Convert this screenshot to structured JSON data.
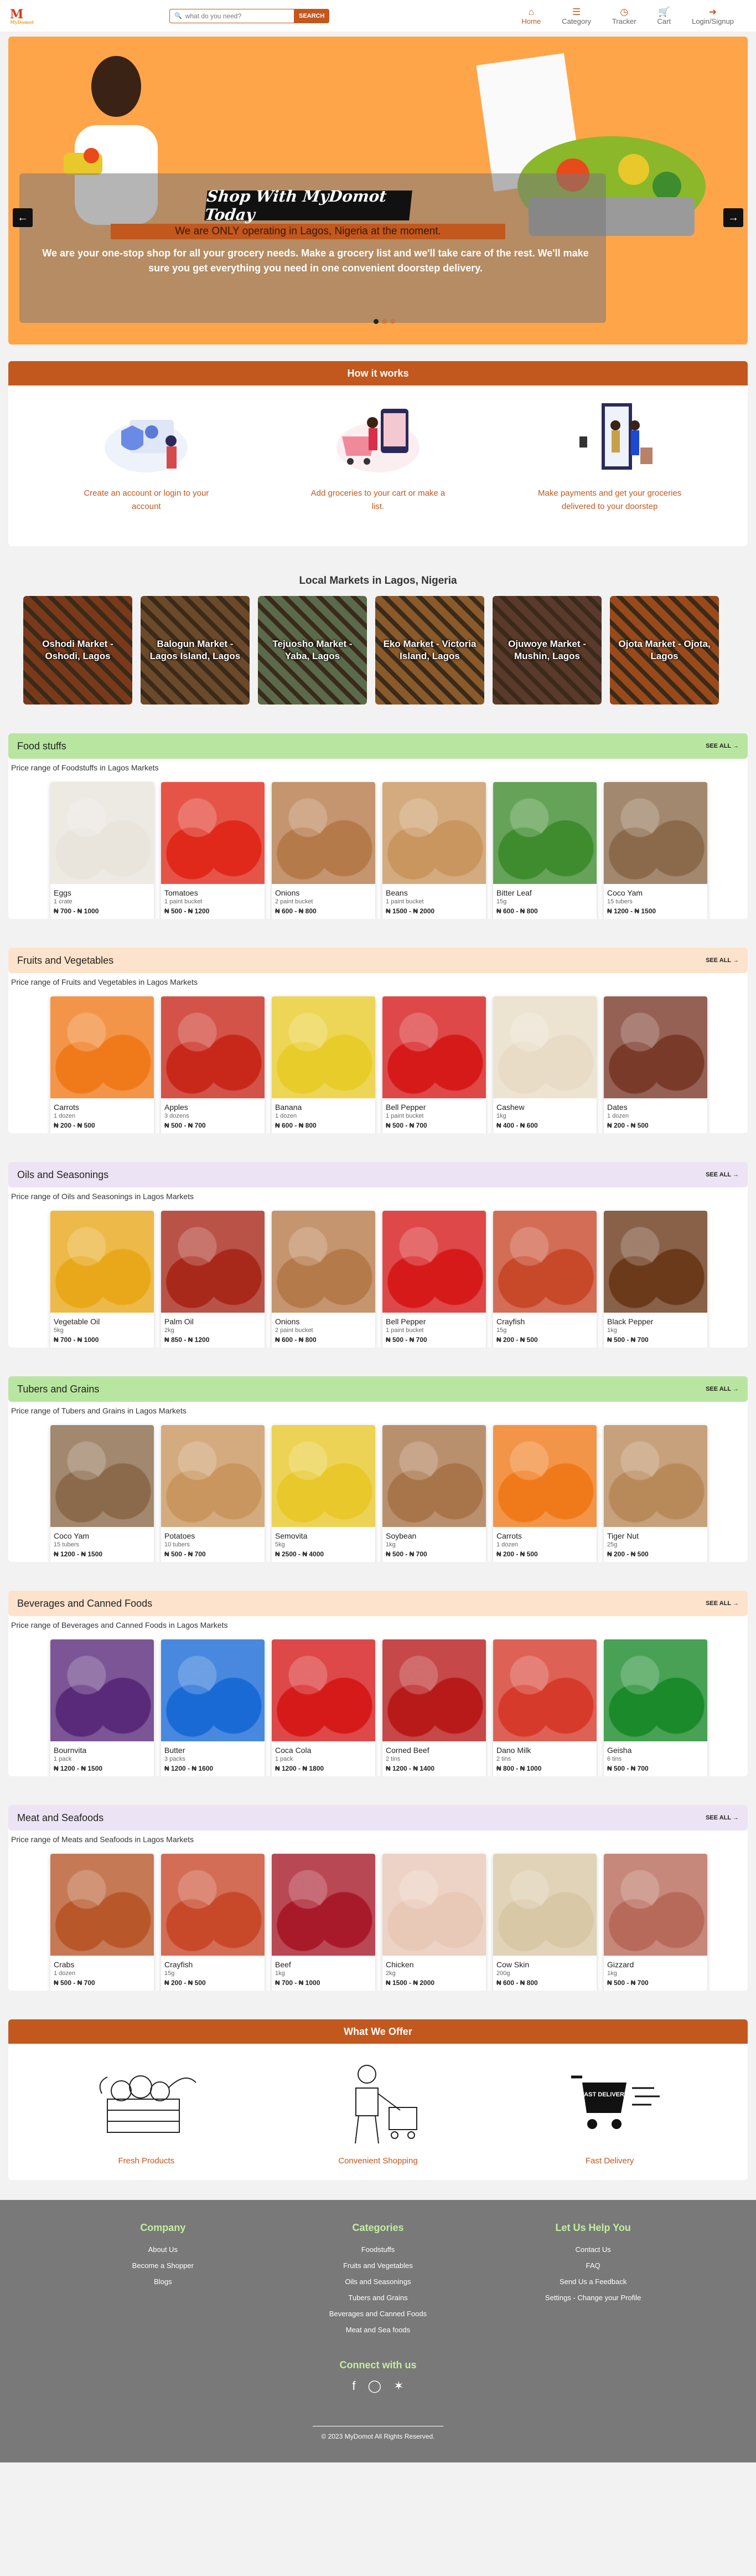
{
  "header": {
    "logo_text": "M",
    "logo_sub": "MyDomot",
    "search": {
      "placeholder": "what do you need?",
      "button_label": "SEARCH"
    },
    "nav": [
      {
        "label": "Home",
        "icon": "home-icon"
      },
      {
        "label": "Category",
        "icon": "list-icon"
      },
      {
        "label": "Tracker",
        "icon": "clock-icon"
      },
      {
        "label": "Cart",
        "icon": "cart-icon",
        "badge": "0"
      },
      {
        "label": "Login/Signup",
        "icon": "login-icon"
      }
    ]
  },
  "hero": {
    "title": "Shop With MyDomot Today",
    "notice": "We are ONLY operating in Lagos, Nigeria at the moment.",
    "description": "We are your one-stop shop for all your grocery needs. Make a grocery list and we'll take care of the rest. We'll make sure you get everything you need in one convenient doorstep delivery.",
    "slides": 3,
    "active_slide": 1
  },
  "how_it_works": {
    "title": "How it works",
    "steps": [
      {
        "text": "Create an account or login to your account"
      },
      {
        "text": "Add groceries to your cart or make a list."
      },
      {
        "text": "Make payments and get your groceries delivered to your doorstep"
      }
    ]
  },
  "markets": {
    "title": "Local Markets in Lagos, Nigeria",
    "items": [
      {
        "name": "Oshodi Market - Oshodi, Lagos",
        "color": "#7a3a1a"
      },
      {
        "name": "Balogun Market - Lagos Island, Lagos",
        "color": "#6b4a2a"
      },
      {
        "name": "Tejuosho Market - Yaba, Lagos",
        "color": "#5a6a4a"
      },
      {
        "name": "Eko Market - Victoria Island, Lagos",
        "color": "#8a5a2a"
      },
      {
        "name": "Ojuwoye Market - Mushin, Lagos",
        "color": "#5a3a2a"
      },
      {
        "name": "Ojota Market - Ojota, Lagos",
        "color": "#9a4a1a"
      }
    ]
  },
  "see_all": "SEE ALL",
  "categories": [
    {
      "title": "Food stuffs",
      "sub": "Price range of Foodstuffs in Lagos Markets",
      "color": "#b8e6a0",
      "products": [
        {
          "name": "Eggs",
          "qty": "1 crate",
          "price": "₦ 700 - ₦ 1000",
          "color": "#e9e4dc"
        },
        {
          "name": "Tomatoes",
          "qty": "1 paint bucket",
          "price": "₦ 500 - ₦ 1200",
          "color": "#e0291a"
        },
        {
          "name": "Onions",
          "qty": "2 paint bucket",
          "price": "₦ 600 - ₦ 800",
          "color": "#b57a4a"
        },
        {
          "name": "Beans",
          "qty": "1 paint bucket",
          "price": "₦ 1500 - ₦ 2000",
          "color": "#c8965e"
        },
        {
          "name": "Bitter Leaf",
          "qty": "15g",
          "price": "₦ 600 - ₦ 800",
          "color": "#3e8c2e"
        },
        {
          "name": "Coco Yam",
          "qty": "15 tubers",
          "price": "₦ 1200 - ₦ 1500",
          "color": "#8a6a4a"
        }
      ]
    },
    {
      "title": "Fruits and Vegetables",
      "sub": "Price range of Fruits and Vegetables in Lagos Markets",
      "color": "#fde3cc",
      "products": [
        {
          "name": "Carrots",
          "qty": "1 dozen",
          "price": "₦ 200 - ₦ 500",
          "color": "#f07a1a"
        },
        {
          "name": "Apples",
          "qty": "3 dozens",
          "price": "₦ 500 - ₦ 700",
          "color": "#c8281a"
        },
        {
          "name": "Banana",
          "qty": "1 dozen",
          "price": "₦ 600 - ₦ 800",
          "color": "#e8cc2a"
        },
        {
          "name": "Bell Pepper",
          "qty": "1 paint bucket",
          "price": "₦ 500 - ₦ 700",
          "color": "#d61a1a"
        },
        {
          "name": "Cashew",
          "qty": "1kg",
          "price": "₦ 400 - ₦ 600",
          "color": "#e8dcc6"
        },
        {
          "name": "Dates",
          "qty": "1 dozen",
          "price": "₦ 200 - ₦ 500",
          "color": "#7a3a2a"
        }
      ]
    },
    {
      "title": "Oils and Seasonings",
      "sub": "Price range of Oils and Seasonings in Lagos Markets",
      "color": "#ece4f4",
      "products": [
        {
          "name": "Vegetable Oil",
          "qty": "5kg",
          "price": "₦ 700 - ₦ 1000",
          "color": "#e8a81a"
        },
        {
          "name": "Palm Oil",
          "qty": "2kg",
          "price": "₦ 850 - ₦ 1200",
          "color": "#a8281a"
        },
        {
          "name": "Onions",
          "qty": "2 paint bucket",
          "price": "₦ 600 - ₦ 800",
          "color": "#b57a4a"
        },
        {
          "name": "Bell Pepper",
          "qty": "1 paint bucket",
          "price": "₦ 500 - ₦ 700",
          "color": "#d61a1a"
        },
        {
          "name": "Crayfish",
          "qty": "15g",
          "price": "₦ 200 - ₦ 500",
          "color": "#c8482a"
        },
        {
          "name": "Black Pepper",
          "qty": "1kg",
          "price": "₦ 500 - ₦ 700",
          "color": "#6a3a1a"
        }
      ]
    },
    {
      "title": "Tubers and Grains",
      "sub": "Price range of Tubers and Grains in Lagos Markets",
      "color": "#b8e6a0",
      "products": [
        {
          "name": "Coco Yam",
          "qty": "15 tubers",
          "price": "₦ 1200 - ₦ 1500",
          "color": "#8a6a4a"
        },
        {
          "name": "Potatoes",
          "qty": "10 tubers",
          "price": "₦ 500 - ₦ 700",
          "color": "#c8965e"
        },
        {
          "name": "Semovita",
          "qty": "5kg",
          "price": "₦ 2500 - ₦ 4000",
          "color": "#e8c82a"
        },
        {
          "name": "Soybean",
          "qty": "1kg",
          "price": "₦ 500 - ₦ 700",
          "color": "#a8744a"
        },
        {
          "name": "Carrots",
          "qty": "1 dozen",
          "price": "₦ 200 - ₦ 500",
          "color": "#f07a1a"
        },
        {
          "name": "Tiger Nut",
          "qty": "25g",
          "price": "₦ 200 - ₦ 500",
          "color": "#b88a5a"
        }
      ]
    },
    {
      "title": "Beverages and Canned Foods",
      "sub": "Price range of Beverages and Canned Foods in Lagos Markets",
      "color": "#fde3cc",
      "products": [
        {
          "name": "Bournvita",
          "qty": "1 pack",
          "price": "₦ 1200 - ₦ 1500",
          "color": "#5a2a7a"
        },
        {
          "name": "Butter",
          "qty": "3 packs",
          "price": "₦ 1200 - ₦ 1600",
          "color": "#1a6ad6"
        },
        {
          "name": "Coca Cola",
          "qty": "1 pack",
          "price": "₦ 1200 - ₦ 1800",
          "color": "#d61a1a"
        },
        {
          "name": "Corned Beef",
          "qty": "2 tins",
          "price": "₦ 1200 - ₦ 1400",
          "color": "#b81a1a"
        },
        {
          "name": "Dano Milk",
          "qty": "2 tins",
          "price": "₦ 800 - ₦ 1000",
          "color": "#d63a2a"
        },
        {
          "name": "Geisha",
          "qty": "6 tins",
          "price": "₦ 500 - ₦ 700",
          "color": "#1a8a2a"
        }
      ]
    },
    {
      "title": "Meat and Seafoods",
      "sub": "Price range of Meats and Seafoods in Lagos Markets",
      "color": "#ece4f4",
      "products": [
        {
          "name": "Crabs",
          "qty": "1 dozen",
          "price": "₦ 500 - ₦ 700",
          "color": "#b8582a"
        },
        {
          "name": "Crayfish",
          "qty": "15g",
          "price": "₦ 200 - ₦ 500",
          "color": "#c8482a"
        },
        {
          "name": "Beef",
          "qty": "1kg",
          "price": "₦ 700 - ₦ 1000",
          "color": "#a81a2a"
        },
        {
          "name": "Chicken",
          "qty": "2kg",
          "price": "₦ 1500 - ₦ 2000",
          "color": "#e8c8b6"
        },
        {
          "name": "Cow Skin",
          "qty": "200g",
          "price": "₦ 600 - ₦ 800",
          "color": "#d8c8a6"
        },
        {
          "name": "Gizzard",
          "qty": "1kg",
          "price": "₦ 500 - ₦ 700",
          "color": "#b86a5a"
        }
      ]
    }
  ],
  "offer": {
    "title": "What We Offer",
    "items": [
      {
        "label": "Fresh Products"
      },
      {
        "label": "Convenient Shopping"
      },
      {
        "label": "Fast Delivery"
      }
    ],
    "truck_label": "FAST DELIVERY"
  },
  "footer": {
    "company": {
      "title": "Company",
      "links": [
        "About Us",
        "Become a Shopper",
        "Blogs"
      ]
    },
    "categories": {
      "title": "Categories",
      "links": [
        "Foodstuffs",
        "Fruits and Vegetables",
        "Oils and Seasonings",
        "Tubers and Grains",
        "Beverages and Canned Foods",
        "Meat and Sea foods"
      ]
    },
    "help": {
      "title": "Let Us Help You",
      "links": [
        "Contact Us",
        "FAQ",
        "Send Us a Feedback",
        "Settings - Change your Profile"
      ]
    },
    "connect_title": "Connect with us",
    "copyright": "© 2023 MyDomot All Rights Reserved."
  }
}
